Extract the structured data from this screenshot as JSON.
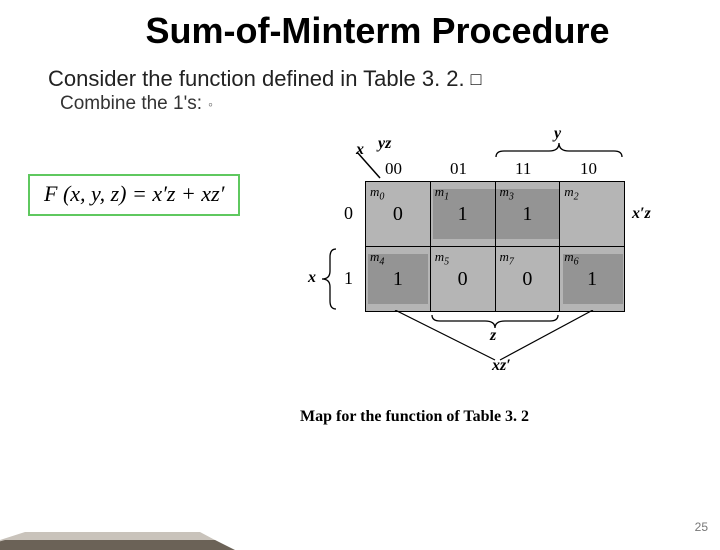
{
  "title": "Sum-of-Minterm Procedure",
  "subtitle": "Consider the function defined in Table 3. 2.",
  "end_square": "□",
  "combine_line": "Combine the 1's:",
  "bullet_mark": "◦",
  "formula": "F (x, y, z) = x′z + xz′",
  "kmap": {
    "axis_x": "x",
    "axis_yz": "yz",
    "col_headers": [
      "00",
      "01",
      "11",
      "10"
    ],
    "row_headers": [
      "0",
      "1"
    ],
    "cells": [
      [
        {
          "m": "m",
          "i": "0",
          "v": "0"
        },
        {
          "m": "m",
          "i": "1",
          "v": "1"
        },
        {
          "m": "m",
          "i": "3",
          "v": "1"
        },
        {
          "m": "m",
          "i": "2",
          "v": ""
        }
      ],
      [
        {
          "m": "m",
          "i": "4",
          "v": "1"
        },
        {
          "m": "m",
          "i": "5",
          "v": "0"
        },
        {
          "m": "m",
          "i": "7",
          "v": "0"
        },
        {
          "m": "m",
          "i": "6",
          "v": "1"
        }
      ]
    ],
    "label_y": "y",
    "label_x": "x",
    "label_z": "z",
    "group_xpz": "x′z",
    "group_xzp": "xz′"
  },
  "caption": "Map for the function of Table 3. 2",
  "page_number": "25"
}
